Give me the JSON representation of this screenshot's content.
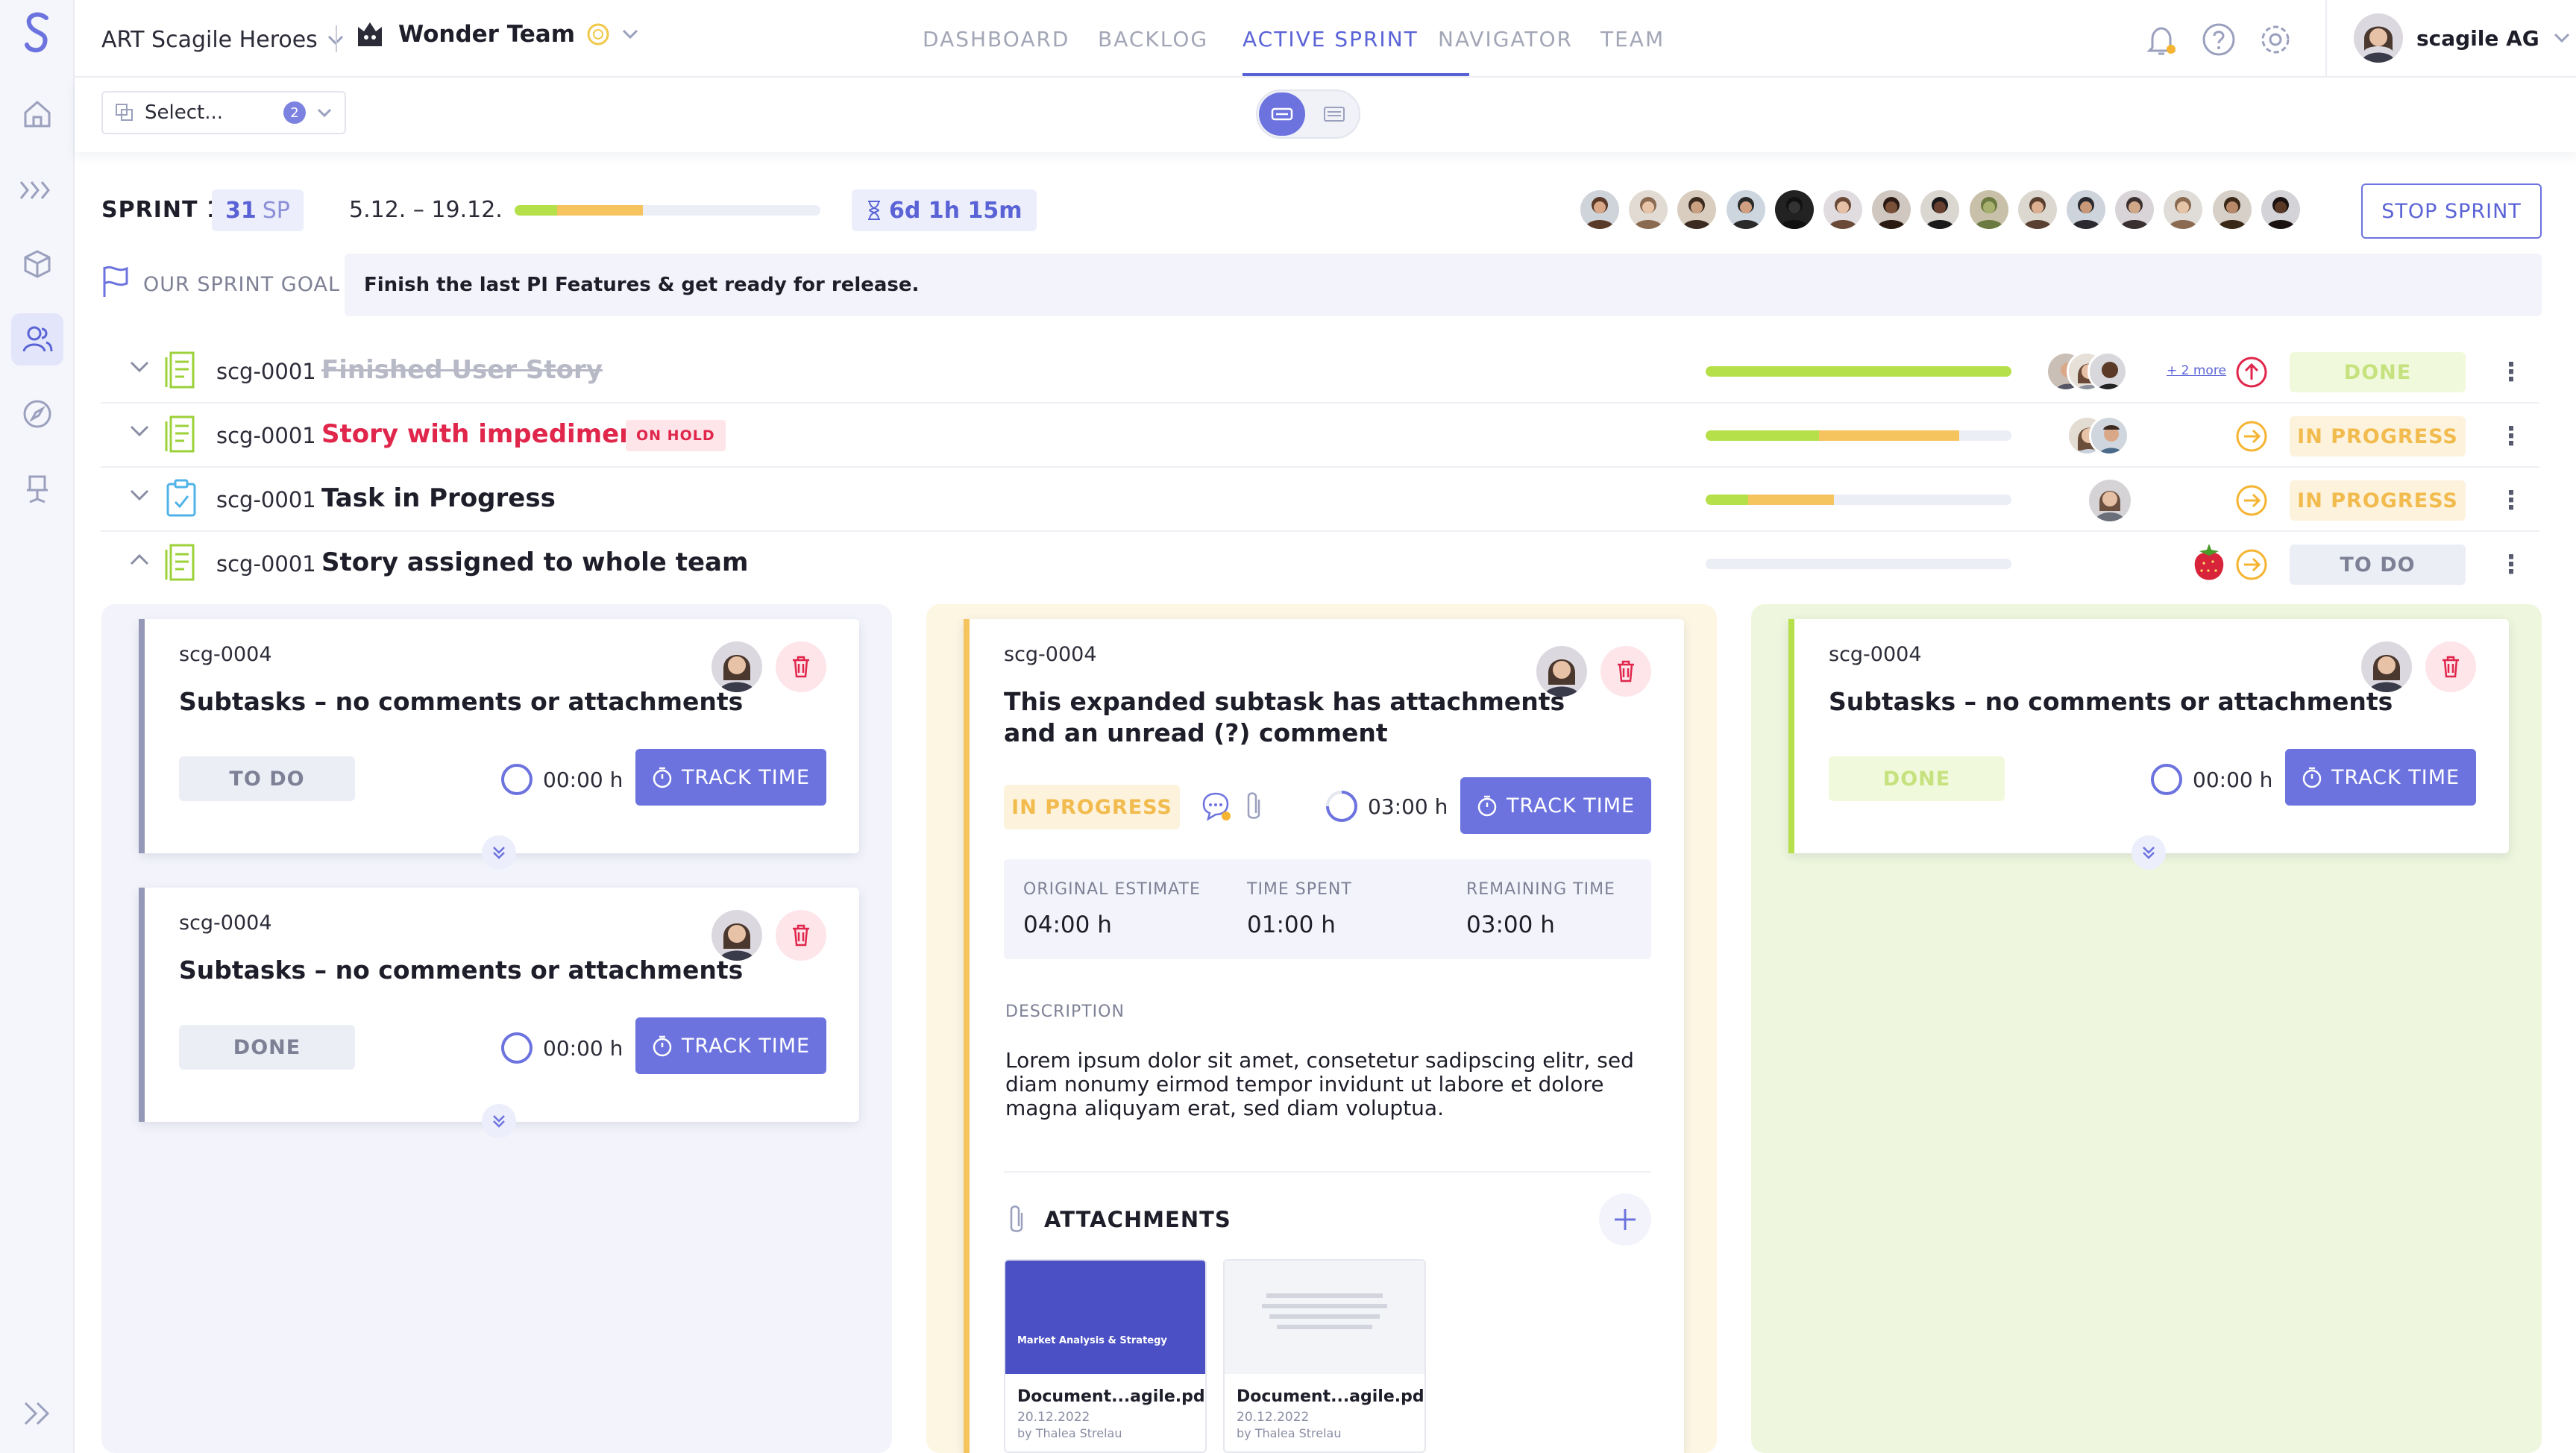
{
  "app": {
    "team_group": "ART Scagile Heroes",
    "team": "Wonder Team"
  },
  "nav": {
    "tabs": [
      {
        "label": "DASHBOARD"
      },
      {
        "label": "BACKLOG"
      },
      {
        "label": "ACTIVE SPRINT",
        "active": true
      },
      {
        "label": "NAVIGATOR"
      },
      {
        "label": "TEAM"
      }
    ]
  },
  "user": {
    "name": "scagile AG"
  },
  "toolbar": {
    "select_placeholder": "Select...",
    "select_count": "2"
  },
  "sprint": {
    "label": "SPRINT 1",
    "points": "31",
    "points_unit": "SP",
    "dates": "5.12. – 19.12.",
    "progress": {
      "done": 0.14,
      "in_progress": 0.28
    },
    "remaining": "6d 1h 15m",
    "stop_label": "STOP SPRINT",
    "goal_label": "OUR SPRINT GOAL",
    "goal_text": "Finish the last PI Features & get ready for release."
  },
  "stories": [
    {
      "id": "scg-0001",
      "title": "Finished User Story",
      "status": "DONE",
      "more": "+ 2 more",
      "progress": {
        "done": 1.0,
        "in_progress": 0.0
      }
    },
    {
      "id": "scg-0001",
      "title": "Story with impediment",
      "badge": "ON HOLD",
      "status": "IN PROGRESS",
      "progress": {
        "done": 0.37,
        "in_progress": 0.46
      }
    },
    {
      "id": "scg-0001",
      "title": "Task in Progress",
      "status": "IN PROGRESS",
      "progress": {
        "done": 0.14,
        "in_progress": 0.28
      }
    },
    {
      "id": "scg-0001",
      "title": "Story assigned to whole team",
      "status": "TO DO",
      "progress": {
        "done": 0.0,
        "in_progress": 0.0
      }
    }
  ],
  "subtasks": {
    "todo_1": {
      "id": "scg-0004",
      "title": "Subtasks – no comments or attachments",
      "status": "TO DO",
      "time": "00:00 h",
      "track": "TRACK TIME"
    },
    "todo_2": {
      "id": "scg-0004",
      "title": "Subtasks – no comments or attachments",
      "status": "DONE",
      "time": "00:00 h",
      "track": "TRACK TIME"
    },
    "expanded": {
      "id": "scg-0004",
      "title_line1": "This expanded subtask has attachments",
      "title_line2": "and an unread (?) comment",
      "status": "IN PROGRESS",
      "time": "03:00 h",
      "track": "TRACK TIME",
      "estimate_label": "ORIGINAL ESTIMATE",
      "estimate": "04:00 h",
      "spent_label": "TIME SPENT",
      "spent": "01:00 h",
      "remaining_label": "REMAINING TIME",
      "remaining": "03:00 h",
      "description_label": "DESCRIPTION",
      "description": "Lorem ipsum dolor sit amet, consetetur sadipscing elitr, sed diam nonumy eirmod tempor invidunt ut labore et dolore magna aliquyam erat, sed diam voluptua.",
      "attachments_label": "ATTACHMENTS",
      "attachments": [
        {
          "name": "Document...agile.pdf",
          "date": "20.12.2022",
          "author": "by Thalea Strelau",
          "thumb_title": "Market Analysis & Strategy"
        },
        {
          "name": "Document...agile.pdf",
          "date": "20.12.2022",
          "author": "by Thalea Strelau"
        }
      ]
    },
    "done_1": {
      "id": "scg-0004",
      "title": "Subtasks – no comments or attachments",
      "status": "DONE",
      "time": "00:00 h",
      "track": "TRACK TIME"
    }
  },
  "colors": {
    "accent": "#6c73de",
    "done": "#b5e04a",
    "in_progress": "#f5c45e",
    "danger": "#e0264b"
  }
}
